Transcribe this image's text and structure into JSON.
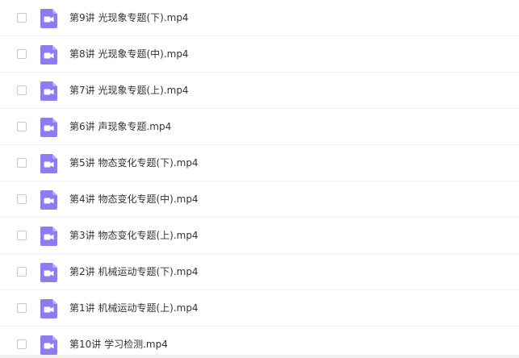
{
  "accent_color": "#8b7cf0",
  "files": [
    {
      "name": "第9讲 光现象专题(下).mp4",
      "icon": "video-file-icon"
    },
    {
      "name": "第8讲 光现象专题(中).mp4",
      "icon": "video-file-icon"
    },
    {
      "name": "第7讲 光现象专题(上).mp4",
      "icon": "video-file-icon"
    },
    {
      "name": "第6讲 声现象专题.mp4",
      "icon": "video-file-icon"
    },
    {
      "name": "第5讲 物态变化专题(下).mp4",
      "icon": "video-file-icon"
    },
    {
      "name": "第4讲 物态变化专题(中).mp4",
      "icon": "video-file-icon"
    },
    {
      "name": "第3讲 物态变化专题(上).mp4",
      "icon": "video-file-icon"
    },
    {
      "name": "第2讲 机械运动专题(下).mp4",
      "icon": "video-file-icon"
    },
    {
      "name": "第1讲 机械运动专题(上).mp4",
      "icon": "video-file-icon"
    },
    {
      "name": "第10讲 学习检测.mp4",
      "icon": "video-file-icon"
    }
  ]
}
